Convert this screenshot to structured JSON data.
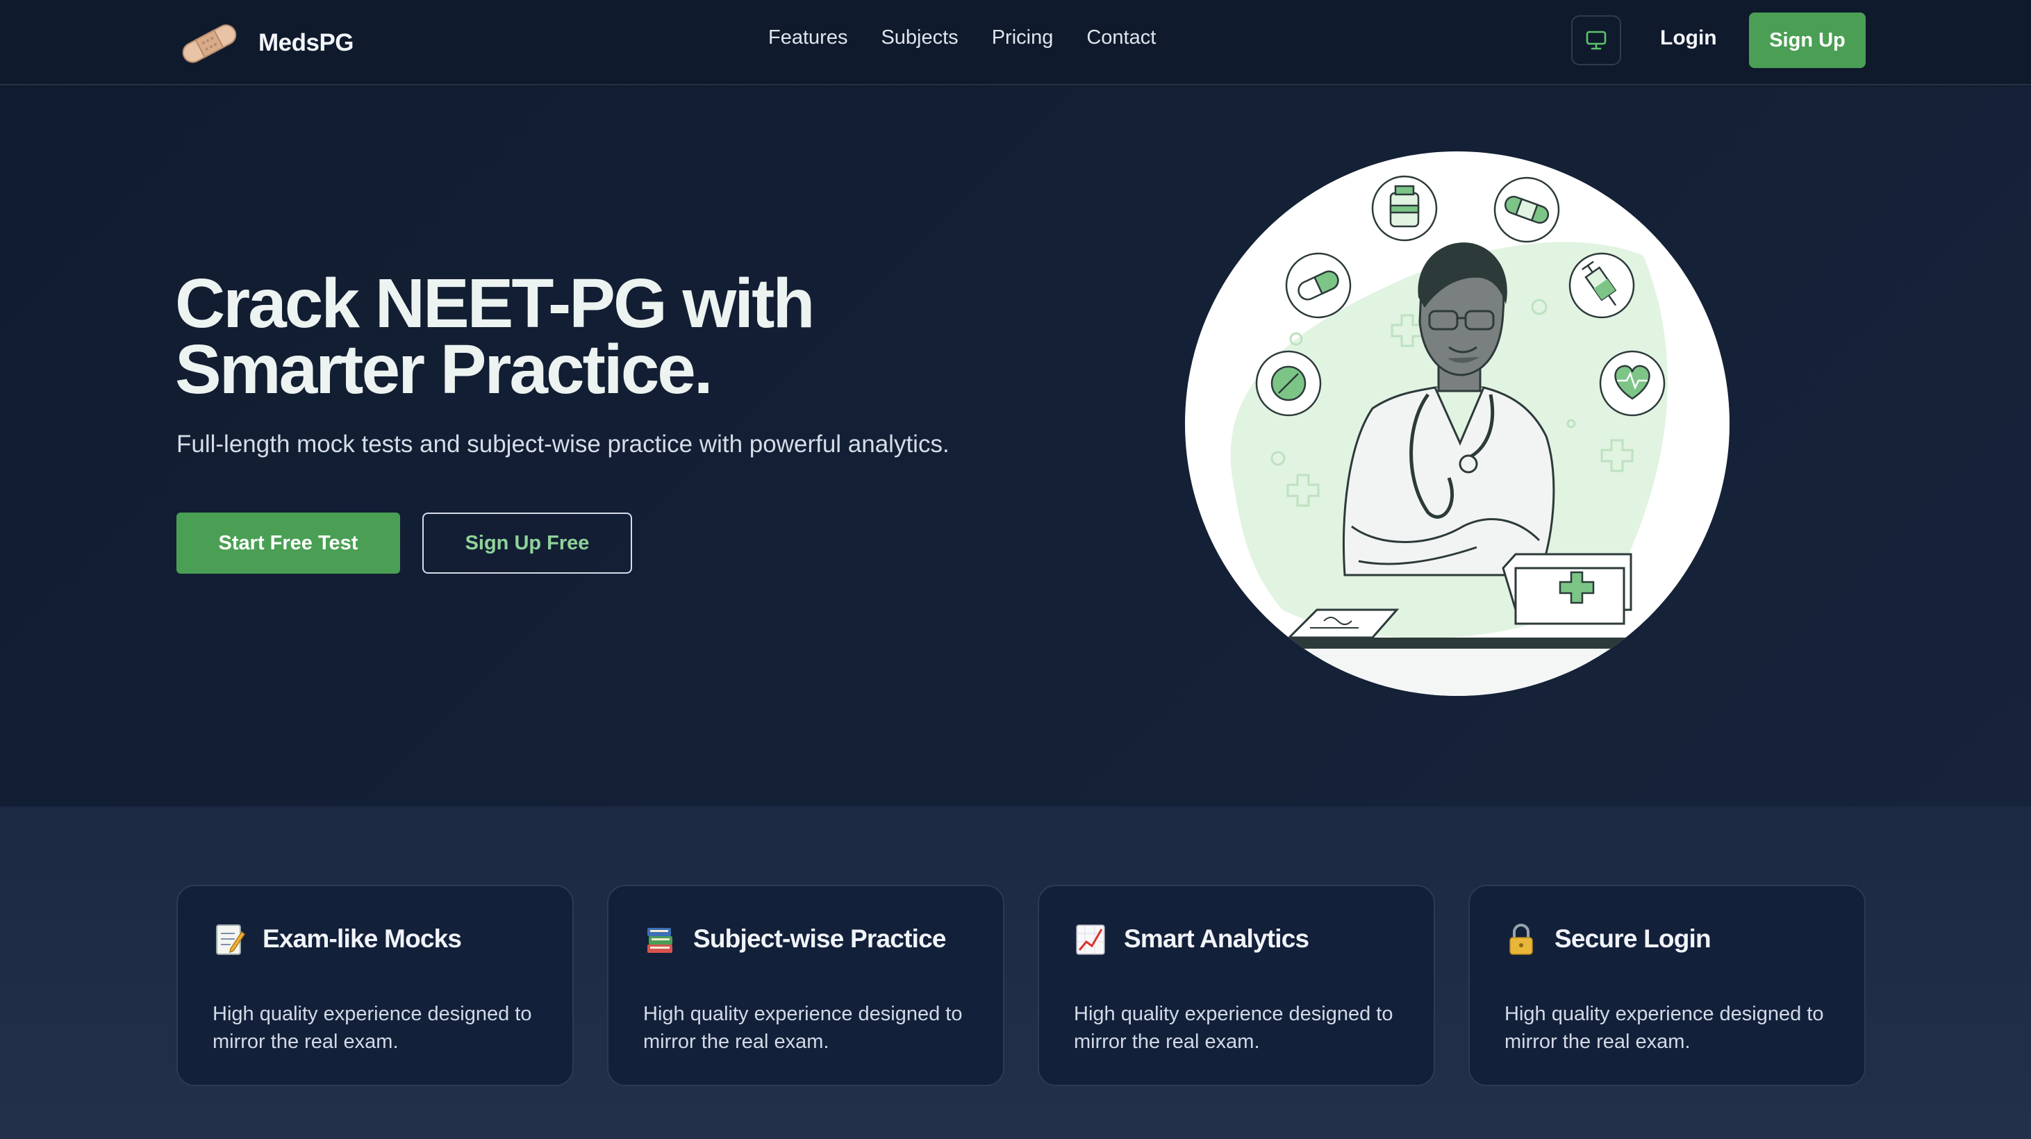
{
  "brand": {
    "name": "MedsPG",
    "logo_icon": "bandage-icon"
  },
  "nav": {
    "links": [
      "Features",
      "Subjects",
      "Pricing",
      "Contact"
    ],
    "theme_icon": "monitor-icon",
    "login": "Login",
    "signup": "Sign Up"
  },
  "hero": {
    "title_line1": "Crack NEET-PG with",
    "title_line2": "Smarter Practice.",
    "subtitle": "Full-length mock tests and subject-wise practice with powerful analytics.",
    "primary_cta": "Start Free Test",
    "secondary_cta": "Sign Up Free",
    "illustration": "doctor-illustration"
  },
  "features": [
    {
      "icon": "memo-icon",
      "title": "Exam-like Mocks",
      "desc": "High quality experience designed to mirror the real exam."
    },
    {
      "icon": "books-icon",
      "title": "Subject-wise Practice",
      "desc": "High quality experience designed to mirror the real exam."
    },
    {
      "icon": "chart-increasing-icon",
      "title": "Smart Analytics",
      "desc": "High quality experience designed to mirror the real exam."
    },
    {
      "icon": "lock-icon",
      "title": "Secure Login",
      "desc": "High quality experience designed to mirror the real exam."
    }
  ],
  "colors": {
    "accent_green": "#4a9f54",
    "light_green": "#8fd39a",
    "background": "#0f1a2c",
    "card": "#13203a"
  }
}
